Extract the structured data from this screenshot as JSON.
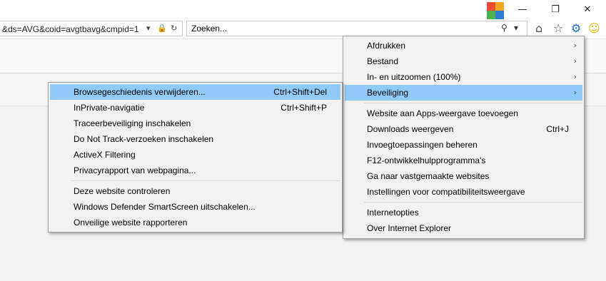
{
  "address": {
    "url_fragment": "&ds=AVG&coid=avgtbavg&cmpid=1",
    "dropdown_icon": "chevron-down-icon",
    "lock_icon": "lock-icon",
    "refresh_icon": "refresh-icon"
  },
  "search": {
    "placeholder": "Zoeken...",
    "search_icon": "search-icon",
    "dropdown_icon": "chevron-down-icon"
  },
  "toolbar_icons": [
    "home-icon",
    "favorites-star-icon",
    "tools-gear-icon",
    "feedback-smiley-icon"
  ],
  "window_controls": {
    "minimize": "—",
    "restore": "❐",
    "close": "✕"
  },
  "tools_menu": {
    "items": [
      {
        "label": "Afdrukken",
        "shortcut": "",
        "submenu": true
      },
      {
        "label": "Bestand",
        "shortcut": "",
        "submenu": true
      },
      {
        "label": "In- en uitzoomen (100%)",
        "shortcut": "",
        "submenu": true
      },
      {
        "label": "Beveiliging",
        "shortcut": "",
        "submenu": true,
        "active": true
      },
      {
        "label": "Website aan Apps-weergave toevoegen",
        "shortcut": ""
      },
      {
        "label": "Downloads weergeven",
        "shortcut": "Ctrl+J"
      },
      {
        "label": "Invoegtoepassingen beheren",
        "shortcut": ""
      },
      {
        "label": "F12-ontwikkelhulpprogramma's",
        "shortcut": ""
      },
      {
        "label": "Ga naar vastgemaakte websites",
        "shortcut": ""
      },
      {
        "label": "Instellingen voor compatibiliteitsweergave",
        "shortcut": ""
      },
      {
        "label": "Internetopties",
        "shortcut": ""
      },
      {
        "label": "Over Internet Explorer",
        "shortcut": ""
      }
    ]
  },
  "security_submenu": {
    "items": [
      {
        "label": "Browsegeschiedenis verwijderen...",
        "shortcut": "Ctrl+Shift+Del",
        "active": true
      },
      {
        "label": "InPrivate-navigatie",
        "shortcut": "Ctrl+Shift+P"
      },
      {
        "label": "Traceerbeveiliging inschakelen",
        "shortcut": ""
      },
      {
        "label": "Do Not Track-verzoeken inschakelen",
        "shortcut": ""
      },
      {
        "label": "ActiveX Filtering",
        "shortcut": ""
      },
      {
        "label": "Privacyrapport van webpagina...",
        "shortcut": ""
      },
      {
        "label": "Deze website controleren",
        "shortcut": ""
      },
      {
        "label": "Windows Defender SmartScreen uitschakelen...",
        "shortcut": ""
      },
      {
        "label": "Onveilige website rapporteren",
        "shortcut": ""
      }
    ]
  },
  "colors": {
    "menu_background": "#f2f2f2",
    "menu_highlight": "#91c9f7",
    "menu_border": "#a0a0a0",
    "logo": [
      "#e94b35",
      "#f7a823",
      "#4caf50",
      "#2d7dd2"
    ]
  }
}
